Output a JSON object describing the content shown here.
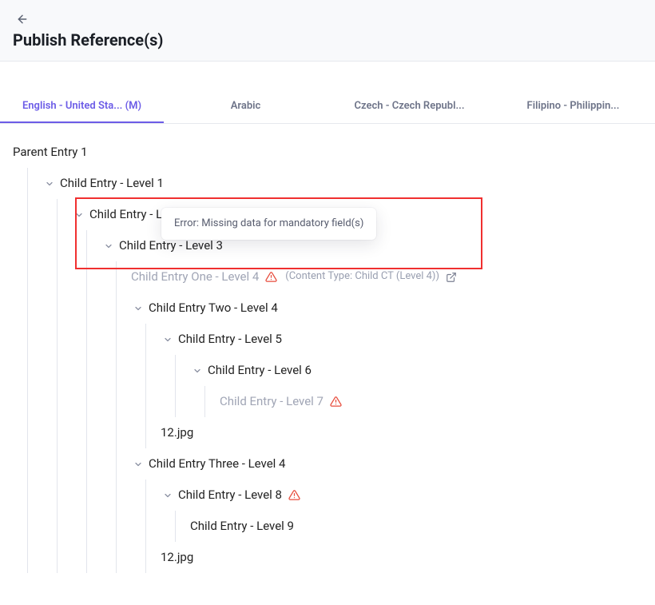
{
  "header": {
    "title": "Publish Reference(s)"
  },
  "tabs": [
    {
      "label": "English - United Sta... (M)",
      "active": true
    },
    {
      "label": "Arabic",
      "active": false
    },
    {
      "label": "Czech - Czech Republ...",
      "active": false
    },
    {
      "label": "Filipino - Philippin...",
      "active": false
    }
  ],
  "tooltip": {
    "text": "Error: Missing data for mandatory field(s)"
  },
  "meta_label": "(Content Type:",
  "meta_value": "Child CT (Level 4))",
  "tree": {
    "parent": "Parent Entry 1",
    "l1": "Child Entry - Level 1",
    "l2": "Child Entry - Level 2",
    "l3": "Child Entry - Level 3",
    "l4a": "Child Entry One - Level 4",
    "l4b": "Child Entry Two - Level 4",
    "l5": "Child Entry - Level 5",
    "l6": "Child Entry - Level 6",
    "l7": "Child Entry - Level 7",
    "file1": "12.jpg",
    "l4c": "Child Entry Three - Level 4",
    "l8": "Child Entry - Level 8",
    "l9": "Child Entry - Level 9",
    "file2": "12.jpg"
  }
}
